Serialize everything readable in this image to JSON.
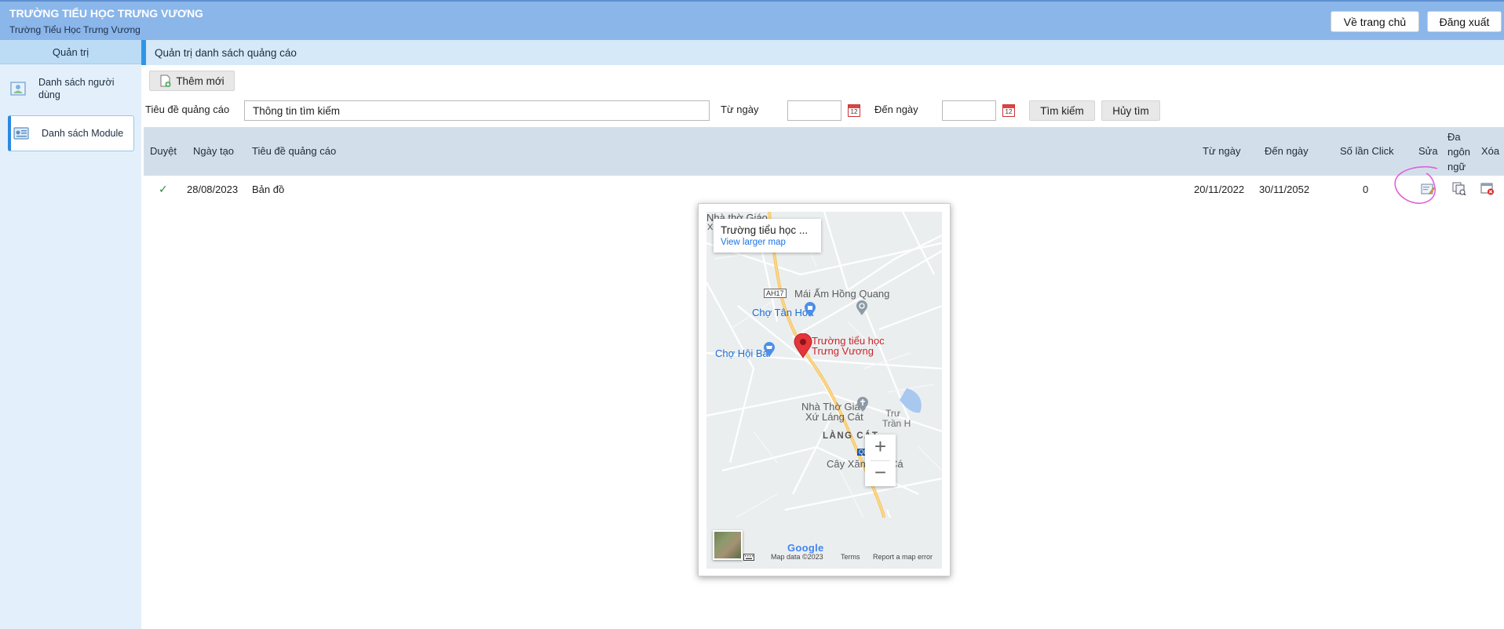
{
  "header": {
    "school_upper": "TRƯỜNG TIỂU HỌC TRƯNG VƯƠNG",
    "school": "Trường Tiểu Học Trưng Vương",
    "home_button": "Về trang chủ",
    "logout_button": "Đăng xuất"
  },
  "sidebar": {
    "heading": "Quản trị",
    "items": [
      {
        "label": "Danh sách người dùng",
        "icon": "user-list-icon"
      },
      {
        "label": "Danh sách Module",
        "icon": "module-list-icon"
      }
    ]
  },
  "main": {
    "title": "Quản trị danh sách quảng cáo",
    "add_button": "Thêm mới",
    "filters": {
      "title_label": "Tiêu đề quảng cáo",
      "title_value": "Thông tin tìm kiếm",
      "from_label": "Từ ngày",
      "from_value": "",
      "to_label": "Đến ngày",
      "to_value": "",
      "calendar_day": "12",
      "search_button": "Tìm kiếm",
      "cancel_button": "Hủy tìm"
    },
    "table": {
      "headers": {
        "approve": "Duyệt",
        "created": "Ngày tạo",
        "title": "Tiêu đề quảng cáo",
        "from": "Từ ngày",
        "to": "Đến ngày",
        "clicks": "Số lần Click",
        "edit": "Sửa",
        "multilang_1": "Đa",
        "multilang_2": "ngôn",
        "multilang_3": "ngữ",
        "delete": "Xóa"
      },
      "rows": [
        {
          "approved": "✓",
          "created": "28/08/2023",
          "title": "Bản đồ",
          "from": "20/11/2022",
          "to": "30/11/2052",
          "clicks": "0"
        }
      ]
    }
  },
  "map": {
    "info_title": "Trường tiểu học ...",
    "info_link": "View larger map",
    "labels": {
      "church_top": "Nhà thờ Giáo",
      "x": "X",
      "road": "AH17",
      "mai_am": "Mái Ấm Hồng Quang",
      "cho_tan_hoa": "Chợ Tân Hoà",
      "school_1": "Trường tiểu học",
      "school_2": "Trưng Vương",
      "cho_hoi_bai": "Chợ Hội Bài",
      "church_1": "Nhà Thờ Giáo",
      "church_2": "Xứ Láng Cát",
      "lang_cat": "LÀNG CÁT",
      "truc_1": "Trư",
      "truc_2": "Trần H",
      "ql": "QL",
      "cay_xang": "Cây Xăng",
      "ca": "Cá"
    },
    "footer": {
      "google": "Google",
      "data": "Map data ©2023",
      "terms": "Terms",
      "report": "Report a map error"
    },
    "zoom_in": "+",
    "zoom_out": "−"
  }
}
